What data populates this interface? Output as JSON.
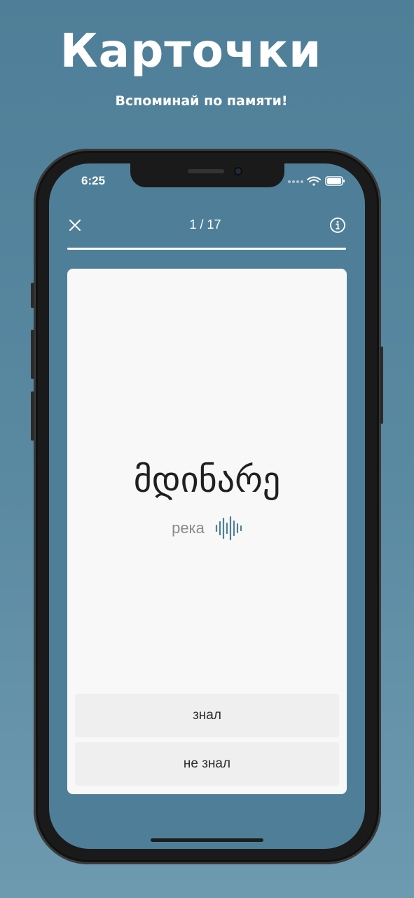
{
  "promo": {
    "title": "Карточки",
    "subtitle": "Вспоминай по памяти!"
  },
  "status_bar": {
    "time": "6:25",
    "icons": [
      "signal-dots-icon",
      "wifi-icon",
      "battery-icon"
    ]
  },
  "top_bar": {
    "close_icon": "close-icon",
    "counter": "1 / 17",
    "info_icon": "info-icon",
    "progress": 1.0
  },
  "card": {
    "word": "მდინარე",
    "translation": "река",
    "audio_icon": "sound-wave-icon"
  },
  "answers": {
    "knew": "знал",
    "didnt_know": "не знал"
  },
  "colors": {
    "background": "#4f7f98",
    "card": "#f8f8f8",
    "button": "#efefef",
    "audio_accent": "#4f7f98"
  }
}
